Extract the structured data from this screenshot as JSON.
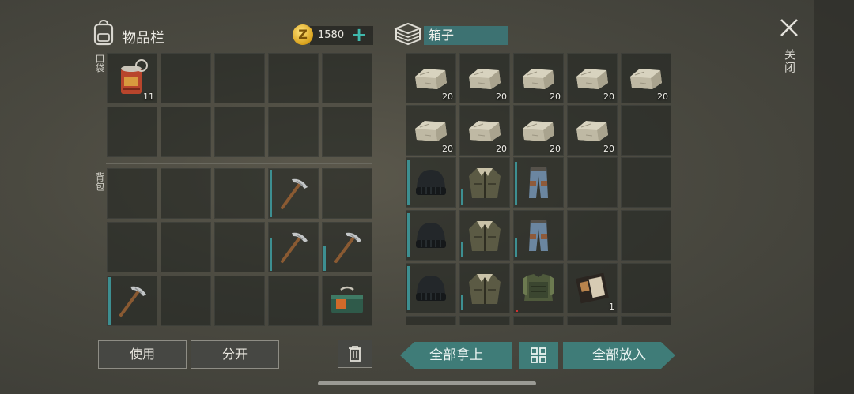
{
  "inventory": {
    "title": "物品栏",
    "pocket_label": "口袋",
    "backpack_label": "背包"
  },
  "currency": {
    "amount": "1580",
    "plus": "+",
    "coin_symbol": "Z"
  },
  "box": {
    "name": "箱子"
  },
  "close": {
    "label": "关闭"
  },
  "buttons": {
    "use": "使用",
    "split": "分开",
    "take_all": "全部拿上",
    "put_all": "全部放入"
  },
  "pocket_items": [
    {
      "icon": "food-can-icon",
      "qty": "11"
    }
  ],
  "backpack_items": [
    {
      "icon": "pickaxe-icon"
    },
    {
      "icon": "pickaxe-icon"
    },
    {
      "icon": "pickaxe-icon"
    },
    {
      "icon": "pickaxe-icon"
    },
    {
      "icon": "supply-crate-icon"
    }
  ],
  "box_items": [
    {
      "icon": "stone-block-icon",
      "qty": "20"
    },
    {
      "icon": "stone-block-icon",
      "qty": "20"
    },
    {
      "icon": "stone-block-icon",
      "qty": "20"
    },
    {
      "icon": "stone-block-icon",
      "qty": "20"
    },
    {
      "icon": "stone-block-icon",
      "qty": "20"
    },
    {
      "icon": "stone-block-icon",
      "qty": "20"
    },
    {
      "icon": "stone-block-icon",
      "qty": "20"
    },
    {
      "icon": "stone-block-icon",
      "qty": "20"
    },
    {
      "icon": "stone-block-icon",
      "qty": "20"
    },
    {
      "icon": "beanie-icon"
    },
    {
      "icon": "jacket-icon"
    },
    {
      "icon": "pants-icon"
    },
    {
      "icon": "beanie-icon"
    },
    {
      "icon": "jacket-icon"
    },
    {
      "icon": "pants-icon"
    },
    {
      "icon": "beanie-icon"
    },
    {
      "icon": "jacket-icon"
    },
    {
      "icon": "armor-vest-icon"
    },
    {
      "icon": "notebook-icon",
      "qty": "1"
    }
  ],
  "colors": {
    "accent": "#3f7c78",
    "box_name_bg": "#3d7272",
    "coin_gold": "#d9a21c"
  }
}
